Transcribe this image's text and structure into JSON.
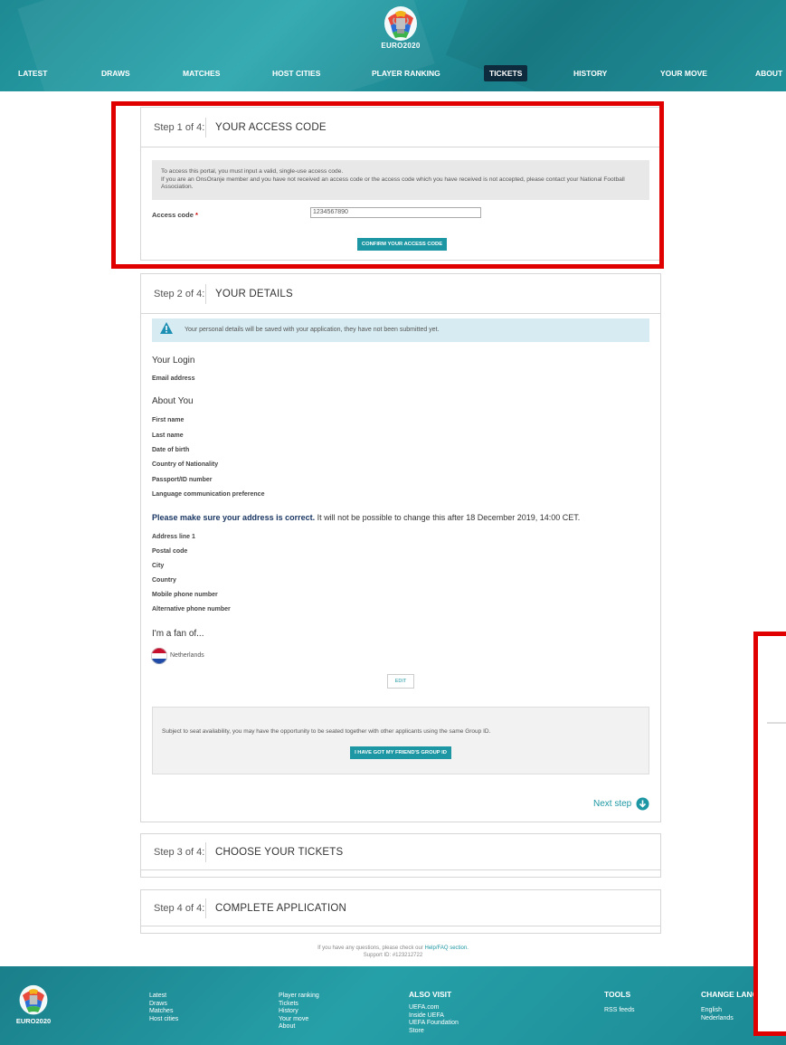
{
  "header": {
    "logo_text": "EURO2020",
    "nav": [
      {
        "label": "LATEST"
      },
      {
        "label": "DRAWS"
      },
      {
        "label": "MATCHES"
      },
      {
        "label": "HOST CITIES"
      },
      {
        "label": "PLAYER RANKING"
      },
      {
        "label": "TICKETS",
        "active": true
      },
      {
        "label": "HISTORY"
      },
      {
        "label": "YOUR MOVE"
      },
      {
        "label": "ABOUT"
      }
    ]
  },
  "step1": {
    "number": "Step 1 of 4:",
    "title": "YOUR ACCESS CODE",
    "info_line1": "To access this portal, you must input a valid, single-use access code.",
    "info_line2": "If you are an OnsOranje member and you have not received an access code or the access code which you have received is not accepted, please contact your National Football Association.",
    "access_label": "Access code",
    "required_mark": "*",
    "access_value": "1234567890",
    "confirm_button": "CONFIRM YOUR ACCESS CODE"
  },
  "step2": {
    "number": "Step 2 of 4:",
    "title": "YOUR DETAILS",
    "notice": "Your personal details will be saved with your application, they have not been submitted yet.",
    "login_title": "Your Login",
    "email_label": "Email address",
    "about_title": "About You",
    "about_fields": [
      "First name",
      "Last name",
      "Date of birth",
      "Country of Nationality",
      "Passport/ID number",
      "Language communication preference"
    ],
    "address_bold": "Please make sure your address is correct.",
    "address_rest": " It will not be possible to change this after 18 December 2019, 14:00 CET.",
    "address_fields": [
      "Address line 1",
      "Postal code",
      "City",
      "Country",
      "Mobile phone number",
      "Alternative phone number"
    ],
    "fan_title": "I'm a fan of...",
    "fan_country": "Netherlands",
    "edit_button": "EDIT",
    "group_text": "Subject to seat availability, you may have the opportunity to be seated together with other applicants using the same Group ID.",
    "group_button": "I HAVE GOT MY FRIEND'S GROUP ID",
    "next_step": "Next step"
  },
  "step3": {
    "number": "Step 3 of 4:",
    "title": "CHOOSE YOUR TICKETS"
  },
  "step4": {
    "number": "Step 4 of 4:",
    "title": "COMPLETE APPLICATION"
  },
  "help": {
    "text": "If you have any questions, please check our ",
    "link": "Help/FAQ section.",
    "support": "Support ID: #123212722"
  },
  "footer": {
    "logo_text": "EURO2020",
    "col1": [
      "Latest",
      "Draws",
      "Matches",
      "Host cities"
    ],
    "col2": [
      "Player ranking",
      "Tickets",
      "History",
      "Your move",
      "About"
    ],
    "also_visit_title": "ALSO VISIT",
    "also_visit": [
      "UEFA.com",
      "Inside UEFA",
      "UEFA Foundation",
      "Store"
    ],
    "tools_title": "TOOLS",
    "tools": [
      "RSS feeds"
    ],
    "lang_title": "CHANGE LANG",
    "langs": [
      "English",
      "Nederlands"
    ]
  },
  "colors": {
    "accent": "#1d97a3",
    "highlight": "#e00000",
    "header": "#1e8a93"
  }
}
